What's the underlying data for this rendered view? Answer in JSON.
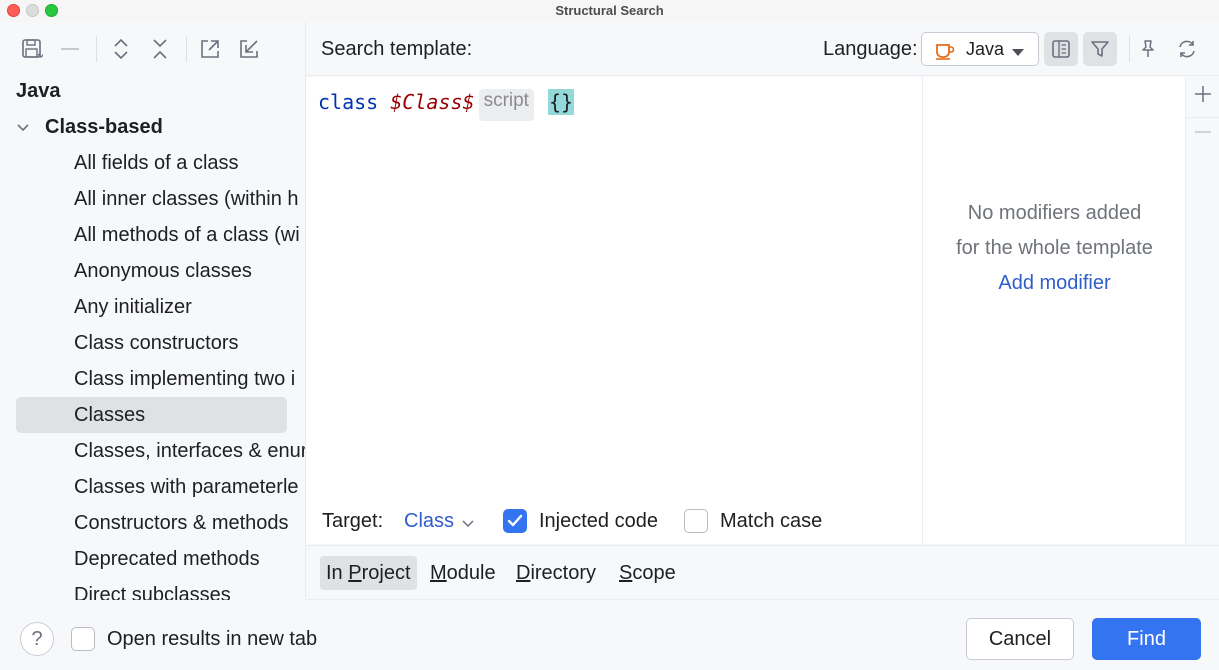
{
  "window": {
    "title": "Structural Search"
  },
  "toolbar": {
    "icons": [
      "save-icon",
      "remove-icon",
      "expand-all-icon",
      "collapse-all-icon",
      "export-icon",
      "import-icon"
    ]
  },
  "tree": {
    "root": "Java",
    "group": "Class-based",
    "items": [
      "All fields of a class",
      "All inner classes (within h",
      "All methods of a class (wi",
      "Anonymous classes",
      "Any initializer",
      "Class constructors",
      "Class implementing two i",
      "Classes",
      "Classes, interfaces & enur",
      "Classes with parameterle",
      "Constructors & methods",
      "Deprecated methods",
      "Direct subclasses"
    ],
    "selected": "Classes"
  },
  "header": {
    "search_label": "Search template:",
    "language_label": "Language:",
    "language_value": "Java"
  },
  "editor": {
    "keyword": "class",
    "variable": "$Class$",
    "inlay_hint": "script",
    "brace": "{}"
  },
  "options": {
    "target_label": "Target:",
    "target_value": "Class",
    "injected_label": "Injected code",
    "injected_checked": true,
    "match_case_label": "Match case",
    "match_case_checked": false
  },
  "modifiers": {
    "line1": "No modifiers added",
    "line2": "for the whole template",
    "link": "Add modifier"
  },
  "scope": {
    "tabs": [
      {
        "pre": "In ",
        "u": "P",
        "post": "roject"
      },
      {
        "pre": "",
        "u": "M",
        "post": "odule"
      },
      {
        "pre": "",
        "u": "D",
        "post": "irectory"
      },
      {
        "pre": "",
        "u": "S",
        "post": "cope"
      }
    ],
    "active": "In Project"
  },
  "bottom": {
    "help": "?",
    "open_new_tab_label": "Open results in new tab",
    "cancel": "Cancel",
    "find": "Find"
  },
  "colors": {
    "accent": "#3574f0",
    "link": "#2f5dc9",
    "selection": "#dfe1e5"
  }
}
